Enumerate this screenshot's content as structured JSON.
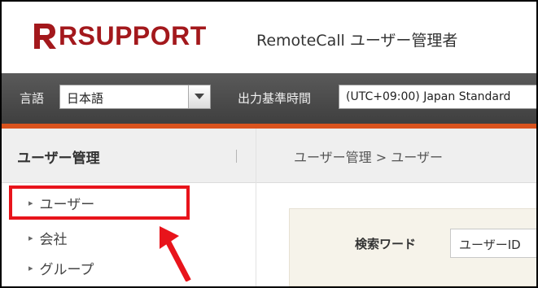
{
  "header": {
    "logo_text": "RSUPPORT",
    "app_title": "RemoteCall ユーザー管理者"
  },
  "topbar": {
    "language_label": "言語",
    "language_value": "日本語",
    "timezone_label": "出力基準時間",
    "timezone_value": "(UTC+09:00) Japan Standard"
  },
  "sidebar": {
    "title": "ユーザー管理",
    "items": [
      {
        "label": "ユーザー"
      },
      {
        "label": "会社"
      },
      {
        "label": "グループ"
      }
    ]
  },
  "main": {
    "breadcrumb": "ユーザー管理 > ユーザー",
    "search_label": "検索ワード",
    "search_type_value": "ユーザーID"
  },
  "colors": {
    "brand": "#a3181c",
    "accent": "#d9531e",
    "annotation": "#e8141b"
  }
}
